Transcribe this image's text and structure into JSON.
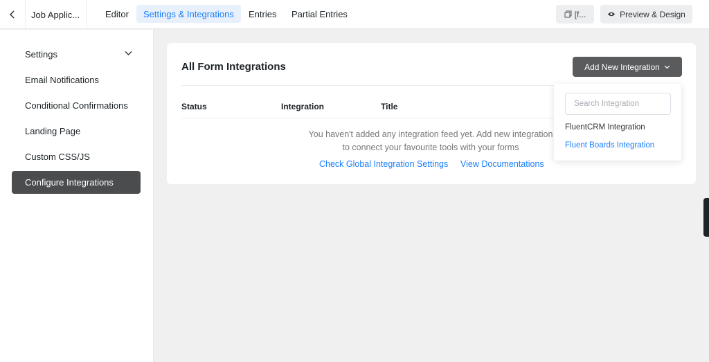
{
  "header": {
    "form_name": "Job Applic...",
    "tabs": [
      {
        "label": "Editor"
      },
      {
        "label": "Settings & Integrations"
      },
      {
        "label": "Entries"
      },
      {
        "label": "Partial Entries"
      }
    ],
    "shortcode_label": "[f...",
    "preview_label": "Preview & Design"
  },
  "sidebar": {
    "items": [
      {
        "label": "Settings"
      },
      {
        "label": "Email Notifications"
      },
      {
        "label": "Conditional Confirmations"
      },
      {
        "label": "Landing Page"
      },
      {
        "label": "Custom CSS/JS"
      },
      {
        "label": "Configure Integrations"
      }
    ]
  },
  "main": {
    "title": "All Form Integrations",
    "add_button_label": "Add New Integration",
    "columns": [
      "Status",
      "Integration",
      "Title"
    ],
    "empty_line1": "You haven't added any integration feed yet. Add new integration",
    "empty_line2": "to connect your favourite tools with your forms",
    "link_global": "Check Global Integration Settings",
    "link_docs": "View Documentations"
  },
  "dropdown": {
    "search_placeholder": "Search Integration",
    "items": [
      {
        "label": "FluentCRM Integration"
      },
      {
        "label": "Fluent Boards Integration"
      }
    ]
  },
  "colors": {
    "accent": "#1a7efb",
    "active_sidebar": "#4b4c4d",
    "primary_button": "#595b5d"
  }
}
